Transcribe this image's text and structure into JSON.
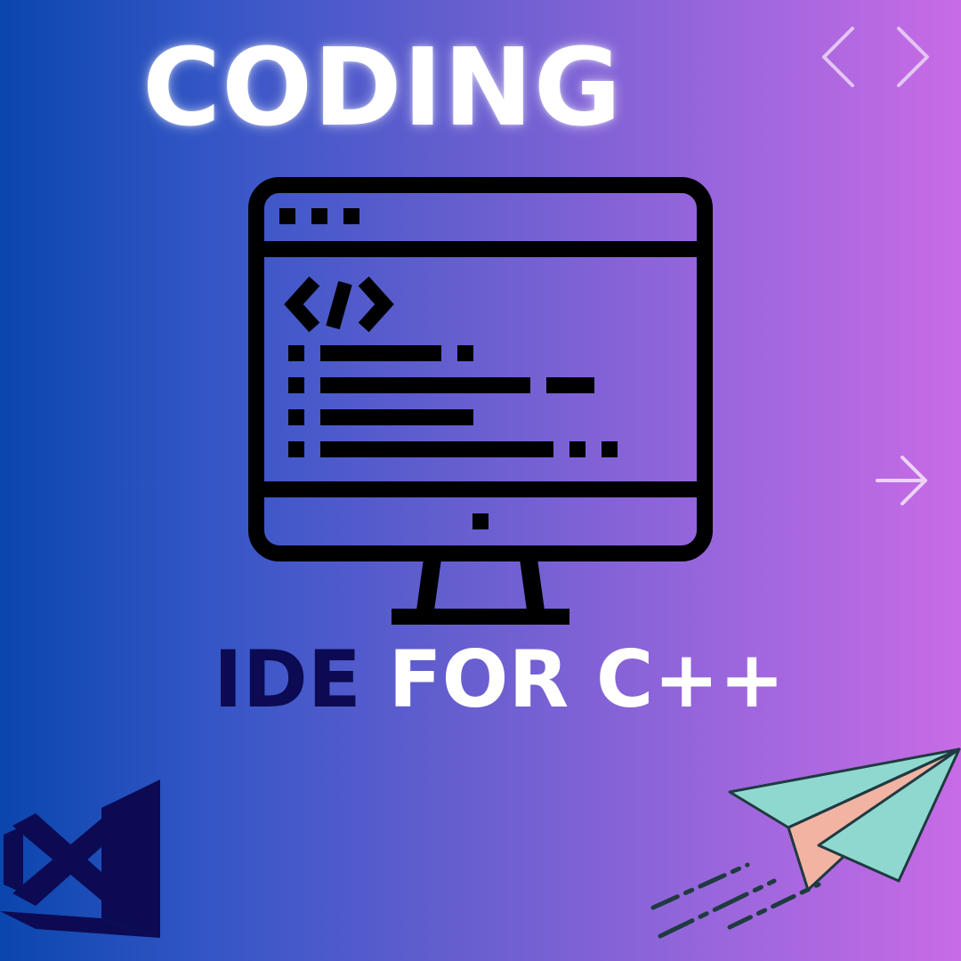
{
  "title": "CODING",
  "subtitle": {
    "part1": "IDE",
    "part2": " FOR C++"
  },
  "colors": {
    "gradient_start": "#0a46ad",
    "gradient_end": "#c86be6",
    "subtitle_accent": "#0c0a52",
    "monitor_stroke": "#000000",
    "logo": "#0c0a52"
  },
  "icons": [
    "code-brackets-icon",
    "monitor-code-icon",
    "arrow-right-icon",
    "visual-studio-logo-icon",
    "paper-plane-icon"
  ]
}
